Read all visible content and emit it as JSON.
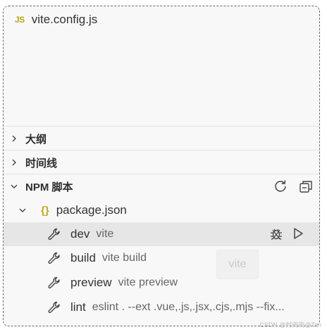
{
  "explorer": {
    "file": {
      "badge": "JS",
      "name": "vite.config.js",
      "icon": "javascript-file-icon"
    }
  },
  "sections": {
    "outline": {
      "title": "大纲",
      "state": "collapsed"
    },
    "timeline": {
      "title": "时间线",
      "state": "collapsed"
    },
    "npm": {
      "title": "NPM 脚本",
      "state": "expanded",
      "actions": [
        {
          "name": "refresh-icon"
        },
        {
          "name": "collapse-all-icon"
        }
      ],
      "package": {
        "icon_text": "{}",
        "name": "package.json",
        "state": "expanded"
      },
      "scripts": [
        {
          "name": "dev",
          "command": "vite",
          "selected": true
        },
        {
          "name": "build",
          "command": "vite build",
          "selected": false
        },
        {
          "name": "preview",
          "command": "vite preview",
          "selected": false
        },
        {
          "name": "lint",
          "command": "eslint . --ext .vue,.js,.jsx,.cjs,.mjs --fix...",
          "selected": false
        }
      ],
      "row_actions": [
        {
          "name": "debug-icon"
        },
        {
          "name": "run-icon"
        }
      ]
    }
  },
  "tooltip": {
    "text": "vite"
  },
  "watermark": {
    "text": "CSDN @时雨雨@Tan"
  },
  "colors": {
    "background": "#f8f8f8",
    "selected_row": "#e6e6e6",
    "js_badge": "#b9a51a",
    "json_braces": "#c3a51a"
  }
}
